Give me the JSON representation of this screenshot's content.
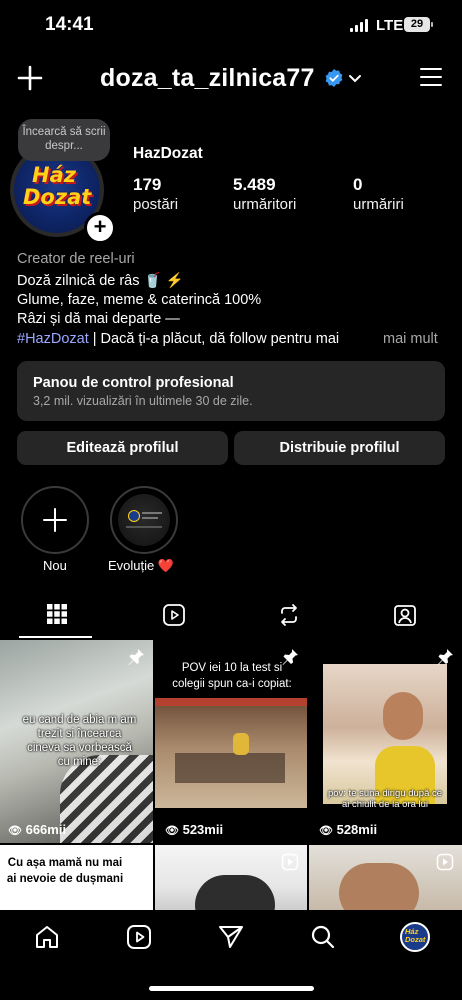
{
  "status_bar": {
    "time": "14:41",
    "network": "LTE",
    "battery": "29"
  },
  "header": {
    "username": "doza_ta_zilnica77"
  },
  "profile": {
    "note": "Încearcă să scrii despr...",
    "display_name": "HazDozat",
    "avatar_text_1": "Ház",
    "avatar_text_2": "Dozat",
    "stats": [
      {
        "value": "179",
        "label": "postări"
      },
      {
        "value": "5.489",
        "label": "urmăritori"
      },
      {
        "value": "0",
        "label": "urmăriri"
      }
    ]
  },
  "bio": {
    "category": "Creator de reel-uri",
    "line1": "Doză zilnică de râs 🥤 ⚡",
    "line2": "Glume, faze, meme & caterincă 100%",
    "line3": "Râzi și dă mai departe —",
    "hashtag": "#HazDozat",
    "line4_rest": " | Dacă ți-a plăcut, dă follow pentru mai",
    "more": "mai mult"
  },
  "dashboard": {
    "title": "Panou de control profesional",
    "subtitle": "3,2 mil. vizualizări în ultimele 30 de zile."
  },
  "buttons": {
    "edit": "Editează profilul",
    "share": "Distribuie profilul"
  },
  "highlights": [
    {
      "label": "Nou"
    },
    {
      "label": "Evoluție ❤️"
    }
  ],
  "posts": [
    {
      "caption": "eu cand de abia m am trezit si încearca cineva sa vorbească cu mine:",
      "views": "666mii",
      "pinned": true
    },
    {
      "caption": "POV iei 10 la test si colegii spun ca-i copiat:",
      "views": "523mii",
      "pinned": true
    },
    {
      "caption": "pov: te suna dirigu după ce ai chiulit de la ora lui",
      "views": "528mii",
      "pinned": true
    },
    {
      "caption": "Cu așa mamă nu mai ai nevoie de dușmani",
      "views": "",
      "pinned": false
    },
    {
      "caption": "",
      "views": "",
      "pinned": false
    },
    {
      "caption": "",
      "views": "",
      "pinned": false
    }
  ],
  "icons": {
    "new_post": "plus-icon",
    "verified": "verified-badge-icon",
    "menu": "hamburger-icon",
    "tabs": [
      "grid-icon",
      "reels-icon",
      "reposts-icon",
      "tagged-icon"
    ],
    "nav": [
      "home-icon",
      "reels-icon",
      "send-icon",
      "search-icon",
      "profile-avatar"
    ]
  },
  "colors": {
    "background": "#000000",
    "card": "#262626",
    "verified": "#3897f0",
    "hashtag": "#9aa8ff"
  }
}
